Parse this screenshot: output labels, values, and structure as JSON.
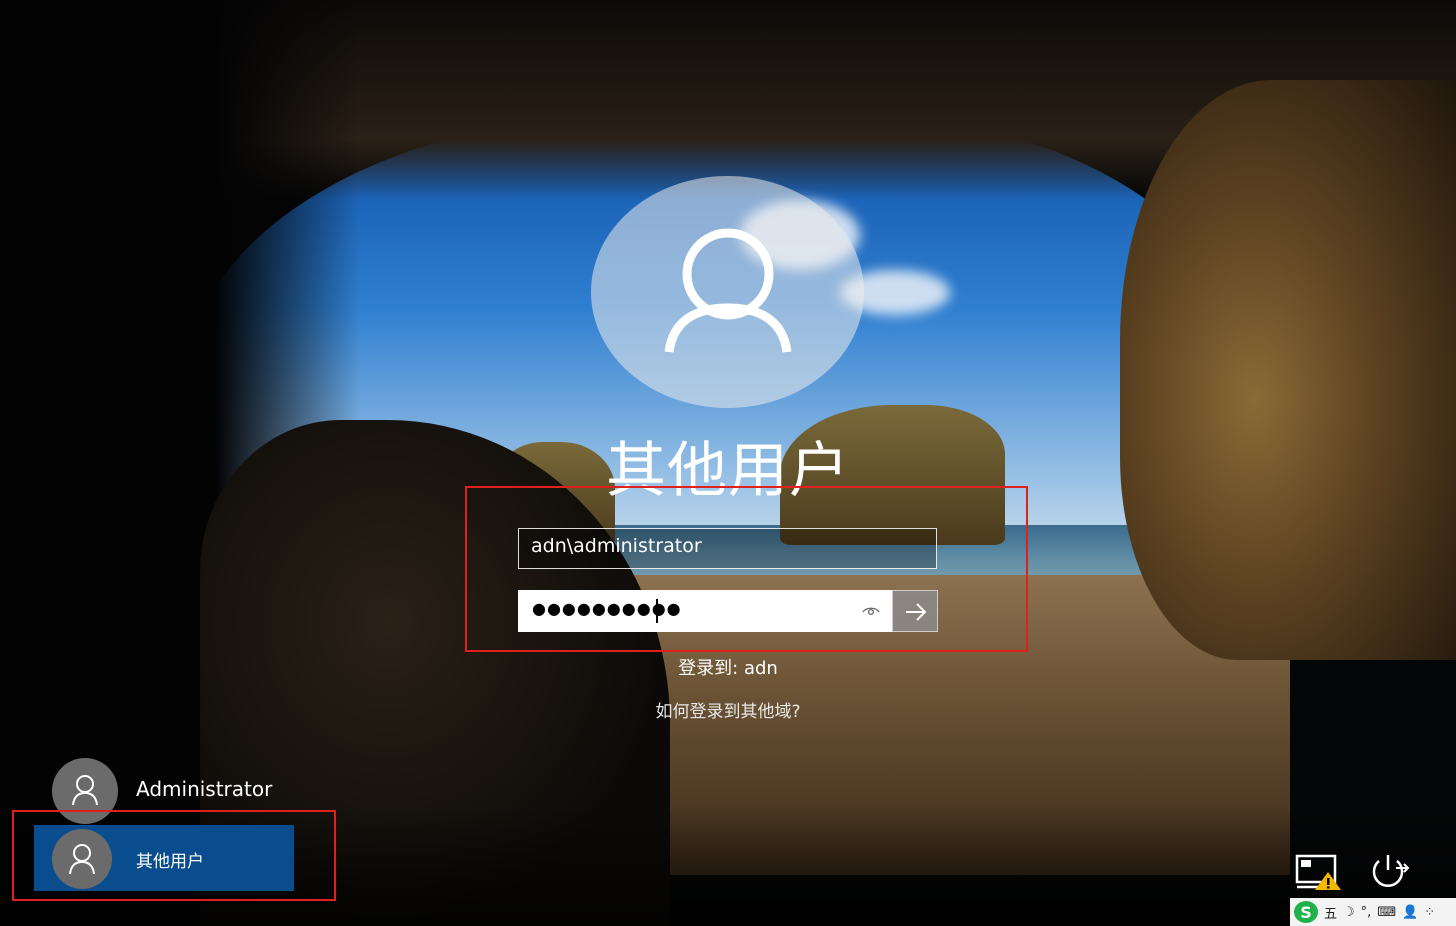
{
  "login": {
    "title": "其他用户",
    "username_value": "adn\\administrator",
    "password_mask": "●●●●●●●●●●",
    "signin_to": "登录到: adn",
    "other_domain_link": "如何登录到其他域?"
  },
  "users": [
    {
      "label": "Administrator"
    },
    {
      "label": "其他用户"
    }
  ],
  "ime": {
    "logo": "S",
    "mode": "五",
    "moon": "☽",
    "punct": "°,",
    "keyboard": "⌨",
    "user": "👤",
    "grid": "⁘"
  },
  "colors": {
    "highlight_border": "#e0201c",
    "selected_tile": "#0a4d8f"
  }
}
